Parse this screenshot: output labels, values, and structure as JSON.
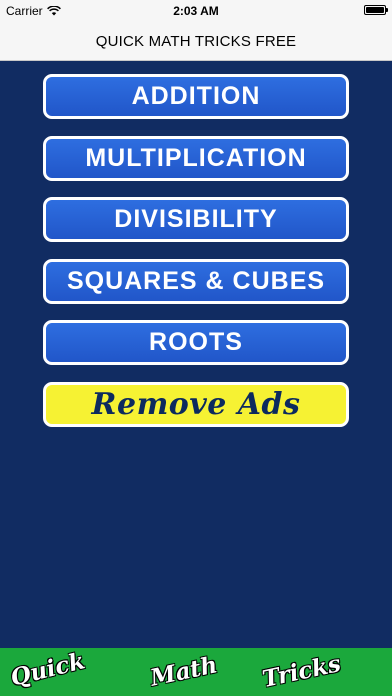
{
  "status_bar": {
    "carrier": "Carrier",
    "time": "2:03 AM",
    "battery_level": 1.0
  },
  "nav_bar": {
    "title": "QUICK MATH TRICKS FREE"
  },
  "menu": {
    "addition": "ADDITION",
    "multiplication": "MULTIPLICATION",
    "divisibility": "DIVISIBILITY",
    "squares_cubes": "SQUARES & CUBES",
    "roots": "ROOTS",
    "remove_ads": "Remove Ads"
  },
  "banner": {
    "word1": "Quick",
    "word2": "Math",
    "word3": "Tricks"
  },
  "colors": {
    "background": "#112c62",
    "button_blue": "#2a63d8",
    "ads_yellow": "#f6f233",
    "banner_green": "#1ba83c"
  },
  "icons": {
    "signal": "wifi-icon",
    "battery": "battery-icon"
  }
}
